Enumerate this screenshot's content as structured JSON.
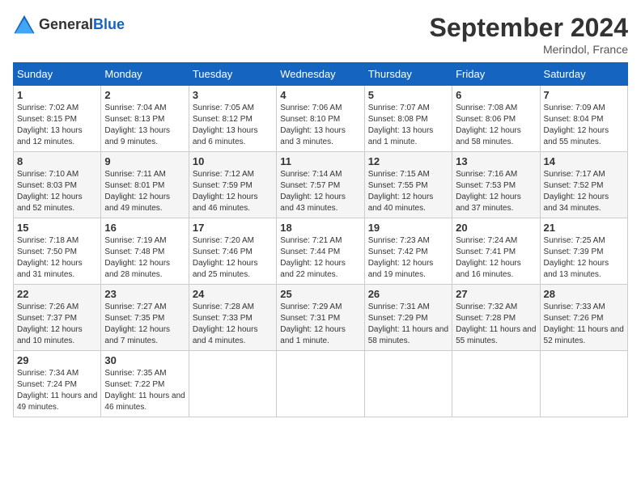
{
  "logo": {
    "general": "General",
    "blue": "Blue"
  },
  "title": "September 2024",
  "location": "Merindol, France",
  "days_of_week": [
    "Sunday",
    "Monday",
    "Tuesday",
    "Wednesday",
    "Thursday",
    "Friday",
    "Saturday"
  ],
  "weeks": [
    [
      {
        "day": "1",
        "sunrise": "7:02 AM",
        "sunset": "8:15 PM",
        "daylight": "13 hours and 12 minutes."
      },
      {
        "day": "2",
        "sunrise": "7:04 AM",
        "sunset": "8:13 PM",
        "daylight": "13 hours and 9 minutes."
      },
      {
        "day": "3",
        "sunrise": "7:05 AM",
        "sunset": "8:12 PM",
        "daylight": "13 hours and 6 minutes."
      },
      {
        "day": "4",
        "sunrise": "7:06 AM",
        "sunset": "8:10 PM",
        "daylight": "13 hours and 3 minutes."
      },
      {
        "day": "5",
        "sunrise": "7:07 AM",
        "sunset": "8:08 PM",
        "daylight": "13 hours and 1 minute."
      },
      {
        "day": "6",
        "sunrise": "7:08 AM",
        "sunset": "8:06 PM",
        "daylight": "12 hours and 58 minutes."
      },
      {
        "day": "7",
        "sunrise": "7:09 AM",
        "sunset": "8:04 PM",
        "daylight": "12 hours and 55 minutes."
      }
    ],
    [
      {
        "day": "8",
        "sunrise": "7:10 AM",
        "sunset": "8:03 PM",
        "daylight": "12 hours and 52 minutes."
      },
      {
        "day": "9",
        "sunrise": "7:11 AM",
        "sunset": "8:01 PM",
        "daylight": "12 hours and 49 minutes."
      },
      {
        "day": "10",
        "sunrise": "7:12 AM",
        "sunset": "7:59 PM",
        "daylight": "12 hours and 46 minutes."
      },
      {
        "day": "11",
        "sunrise": "7:14 AM",
        "sunset": "7:57 PM",
        "daylight": "12 hours and 43 minutes."
      },
      {
        "day": "12",
        "sunrise": "7:15 AM",
        "sunset": "7:55 PM",
        "daylight": "12 hours and 40 minutes."
      },
      {
        "day": "13",
        "sunrise": "7:16 AM",
        "sunset": "7:53 PM",
        "daylight": "12 hours and 37 minutes."
      },
      {
        "day": "14",
        "sunrise": "7:17 AM",
        "sunset": "7:52 PM",
        "daylight": "12 hours and 34 minutes."
      }
    ],
    [
      {
        "day": "15",
        "sunrise": "7:18 AM",
        "sunset": "7:50 PM",
        "daylight": "12 hours and 31 minutes."
      },
      {
        "day": "16",
        "sunrise": "7:19 AM",
        "sunset": "7:48 PM",
        "daylight": "12 hours and 28 minutes."
      },
      {
        "day": "17",
        "sunrise": "7:20 AM",
        "sunset": "7:46 PM",
        "daylight": "12 hours and 25 minutes."
      },
      {
        "day": "18",
        "sunrise": "7:21 AM",
        "sunset": "7:44 PM",
        "daylight": "12 hours and 22 minutes."
      },
      {
        "day": "19",
        "sunrise": "7:23 AM",
        "sunset": "7:42 PM",
        "daylight": "12 hours and 19 minutes."
      },
      {
        "day": "20",
        "sunrise": "7:24 AM",
        "sunset": "7:41 PM",
        "daylight": "12 hours and 16 minutes."
      },
      {
        "day": "21",
        "sunrise": "7:25 AM",
        "sunset": "7:39 PM",
        "daylight": "12 hours and 13 minutes."
      }
    ],
    [
      {
        "day": "22",
        "sunrise": "7:26 AM",
        "sunset": "7:37 PM",
        "daylight": "12 hours and 10 minutes."
      },
      {
        "day": "23",
        "sunrise": "7:27 AM",
        "sunset": "7:35 PM",
        "daylight": "12 hours and 7 minutes."
      },
      {
        "day": "24",
        "sunrise": "7:28 AM",
        "sunset": "7:33 PM",
        "daylight": "12 hours and 4 minutes."
      },
      {
        "day": "25",
        "sunrise": "7:29 AM",
        "sunset": "7:31 PM",
        "daylight": "12 hours and 1 minute."
      },
      {
        "day": "26",
        "sunrise": "7:31 AM",
        "sunset": "7:29 PM",
        "daylight": "11 hours and 58 minutes."
      },
      {
        "day": "27",
        "sunrise": "7:32 AM",
        "sunset": "7:28 PM",
        "daylight": "11 hours and 55 minutes."
      },
      {
        "day": "28",
        "sunrise": "7:33 AM",
        "sunset": "7:26 PM",
        "daylight": "11 hours and 52 minutes."
      }
    ],
    [
      {
        "day": "29",
        "sunrise": "7:34 AM",
        "sunset": "7:24 PM",
        "daylight": "11 hours and 49 minutes."
      },
      {
        "day": "30",
        "sunrise": "7:35 AM",
        "sunset": "7:22 PM",
        "daylight": "11 hours and 46 minutes."
      },
      null,
      null,
      null,
      null,
      null
    ]
  ]
}
